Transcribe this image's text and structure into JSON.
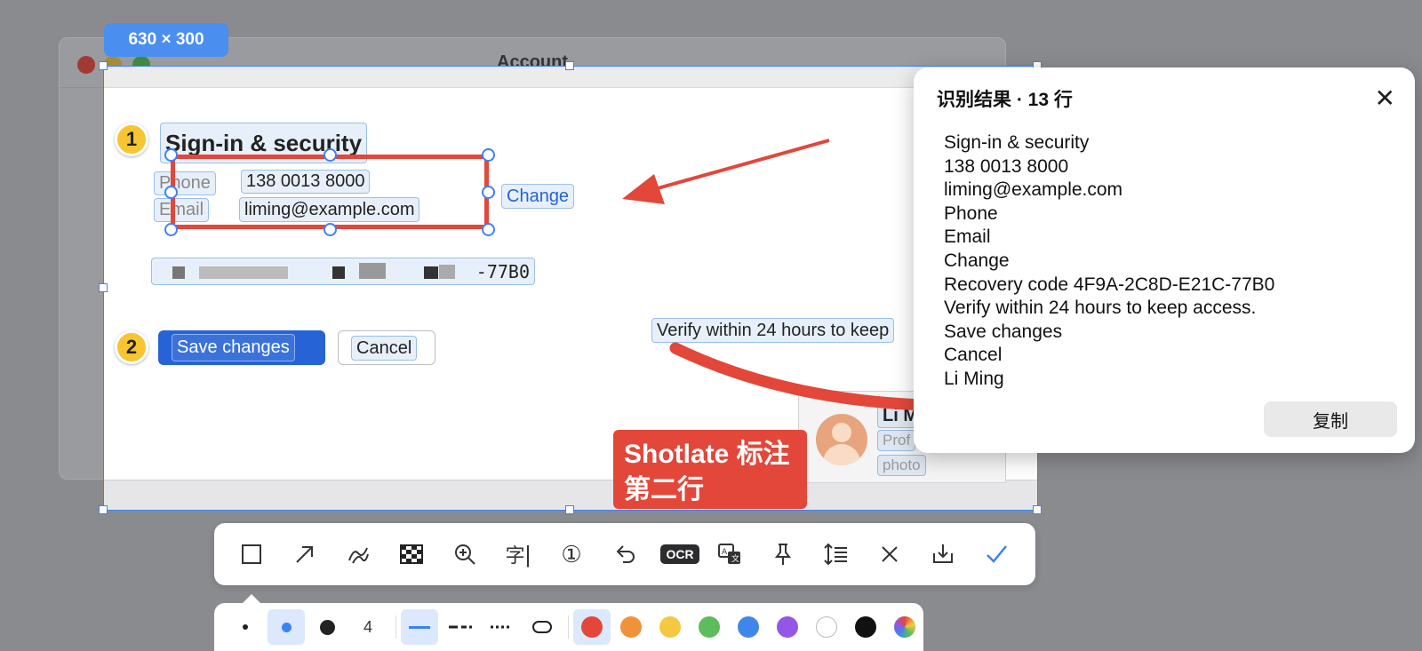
{
  "background_window": {
    "title": "Account"
  },
  "selection": {
    "size_label": "630 × 300"
  },
  "content": {
    "step1": "1",
    "step2": "2",
    "heading": "Sign-in & security",
    "phone_label": "Phone",
    "phone_value": "138 0013 8000",
    "email_label": "Email",
    "email_value": "liming@example.com",
    "change_link": "Change",
    "recovery_visible": "-77B0",
    "verify_text": "Verify within 24 hours to keep",
    "save_button": "Save changes",
    "cancel_button": "Cancel",
    "profile_name": "Li M",
    "profile_sub": "Prof",
    "profile_photo": "photo"
  },
  "annotation": {
    "text": "Shotlate 标注\n第二行",
    "color": "#e2473a"
  },
  "ocr_panel": {
    "title": "识别结果 · 13 行",
    "lines": [
      "Sign-in & security",
      "138 0013 8000",
      "liming@example.com",
      "Phone",
      "Email",
      "Change",
      "Recovery code 4F9A-2C8D-E21C-77B0",
      "Verify within 24 hours to keep access.",
      "Save changes",
      "Cancel",
      "Li Ming"
    ],
    "copy_button": "复制"
  },
  "toolbar": {
    "tools": [
      "rectangle-icon",
      "arrow-icon",
      "pen-icon",
      "mosaic-icon",
      "magnifier-icon",
      "text-icon",
      "number-icon",
      "undo-icon",
      "ocr-icon",
      "translate-icon",
      "pin-icon",
      "scroll-capture-icon",
      "close-icon",
      "save-icon",
      "confirm-icon"
    ],
    "ocr_label": "OCR",
    "text_tool_label": "字",
    "number_tool_label": "①"
  },
  "subbar": {
    "stroke_width_value": "4",
    "colors": [
      "#e2473a",
      "#f0923a",
      "#f5c842",
      "#5cbd5a",
      "#3f86ea",
      "#9356e6",
      "#ffffff",
      "#111111"
    ],
    "accent": "#3b82f6"
  }
}
